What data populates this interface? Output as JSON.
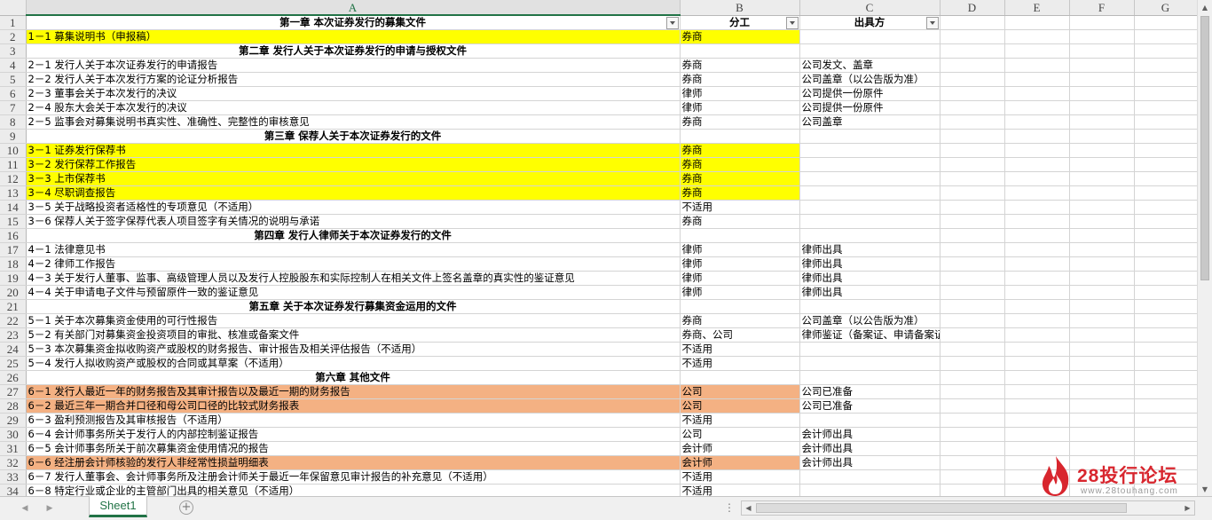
{
  "columns": [
    "A",
    "B",
    "C",
    "D",
    "E",
    "F",
    "G"
  ],
  "header": {
    "col_a": "第一章 本次证券发行的募集文件",
    "col_b": "分工",
    "col_c": "出具方"
  },
  "rows": [
    {
      "n": "2",
      "a": "1－1 募集说明书（申报稿）",
      "b": "券商",
      "c": "",
      "fill": "yellow"
    },
    {
      "n": "3",
      "section": "第二章 发行人关于本次证券发行的申请与授权文件"
    },
    {
      "n": "4",
      "a": "2－1 发行人关于本次证券发行的申请报告",
      "b": "券商",
      "c": "公司发文、盖章"
    },
    {
      "n": "5",
      "a": "2－2 发行人关于本次发行方案的论证分析报告",
      "b": "券商",
      "c": "公司盖章（以公告版为准）"
    },
    {
      "n": "6",
      "a": "2－3 董事会关于本次发行的决议",
      "b": "律师",
      "c": "公司提供一份原件"
    },
    {
      "n": "7",
      "a": "2－4 股东大会关于本次发行的决议",
      "b": "律师",
      "c": "公司提供一份原件"
    },
    {
      "n": "8",
      "a": "2－5 监事会对募集说明书真实性、准确性、完整性的审核意见",
      "b": "券商",
      "c": "公司盖章"
    },
    {
      "n": "9",
      "section": "第三章 保荐人关于本次证券发行的文件"
    },
    {
      "n": "10",
      "a": "3－1 证券发行保荐书",
      "b": "券商",
      "c": "",
      "fill": "yellow"
    },
    {
      "n": "11",
      "a": "3－2 发行保荐工作报告",
      "b": "券商",
      "c": "",
      "fill": "yellow"
    },
    {
      "n": "12",
      "a": "3－3 上市保荐书",
      "b": "券商",
      "c": "",
      "fill": "yellow"
    },
    {
      "n": "13",
      "a": "3－4 尽职调查报告",
      "b": "券商",
      "c": "",
      "fill": "yellow"
    },
    {
      "n": "14",
      "a": "3－5 关于战略投资者适格性的专项意见（不适用）",
      "b": "不适用",
      "c": ""
    },
    {
      "n": "15",
      "a": "3－6 保荐人关于签字保荐代表人项目签字有关情况的说明与承诺",
      "b": "券商",
      "c": ""
    },
    {
      "n": "16",
      "section": "第四章 发行人律师关于本次证券发行的文件"
    },
    {
      "n": "17",
      "a": "4－1 法律意见书",
      "b": "律师",
      "c": "律师出具"
    },
    {
      "n": "18",
      "a": "4－2 律师工作报告",
      "b": "律师",
      "c": "律师出具"
    },
    {
      "n": "19",
      "a": "4－3 关于发行人董事、监事、高级管理人员以及发行人控股股东和实际控制人在相关文件上签名盖章的真实性的鉴证意见",
      "b": "律师",
      "c": "律师出具"
    },
    {
      "n": "20",
      "a": "4－4 关于申请电子文件与预留原件一致的鉴证意见",
      "b": "律师",
      "c": "律师出具"
    },
    {
      "n": "21",
      "section": "第五章 关于本次证券发行募集资金运用的文件"
    },
    {
      "n": "22",
      "a": "5－1 关于本次募集资金使用的可行性报告",
      "b": "券商",
      "c": "公司盖章（以公告版为准）"
    },
    {
      "n": "23",
      "a": "5－2 有关部门对募集资金投资项目的审批、核准或备案文件",
      "b": "券商、公司",
      "c": "律师鉴证（备案证、申请备案证官网截图）"
    },
    {
      "n": "24",
      "a": "5－3 本次募集资金拟收购资产或股权的财务报告、审计报告及相关评估报告（不适用）",
      "b": "不适用",
      "c": ""
    },
    {
      "n": "25",
      "a": "5－4 发行人拟收购资产或股权的合同或其草案（不适用）",
      "b": "不适用",
      "c": ""
    },
    {
      "n": "26",
      "section": "第六章 其他文件"
    },
    {
      "n": "27",
      "a": "6－1 发行人最近一年的财务报告及其审计报告以及最近一期的财务报告",
      "b": "公司",
      "c": "公司已准备",
      "fill": "orange"
    },
    {
      "n": "28",
      "a": "6－2 最近三年一期合并口径和母公司口径的比较式财务报表",
      "b": "公司",
      "c": "公司已准备",
      "fill": "orange"
    },
    {
      "n": "29",
      "a": "6－3 盈利预测报告及其审核报告（不适用）",
      "b": "不适用",
      "c": ""
    },
    {
      "n": "30",
      "a": "6－4 会计师事务所关于发行人的内部控制鉴证报告",
      "b": "公司",
      "c": "会计师出具"
    },
    {
      "n": "31",
      "a": "6－5 会计师事务所关于前次募集资金使用情况的报告",
      "b": "会计师",
      "c": "会计师出具"
    },
    {
      "n": "32",
      "a": "6－6 经注册会计师核验的发行人非经常性损益明细表",
      "b": "会计师",
      "c": "会计师出具",
      "fill": "orange"
    },
    {
      "n": "33",
      "a": "6－7 发行人董事会、会计师事务所及注册会计师关于最近一年保留意见审计报告的补充意见（不适用）",
      "b": "不适用",
      "c": ""
    },
    {
      "n": "34",
      "a": "6－8 特定行业或企业的主管部门出具的相关意见（不适用）",
      "b": "不适用",
      "c": ""
    }
  ],
  "sheet_tabs": [
    "Sheet1"
  ],
  "fills": {
    "yellow": "#ffff00",
    "orange": "#f4b183"
  },
  "watermark": {
    "logo_text": "28投行论坛",
    "url": "www.28touhang.com",
    "color": "#d8262e"
  },
  "icons": [
    "filter-dropdown-icon",
    "add-sheet-icon",
    "scroll-left-icon",
    "scroll-right-icon",
    "scroll-up-icon",
    "scroll-down-icon",
    "flame-logo-icon"
  ]
}
